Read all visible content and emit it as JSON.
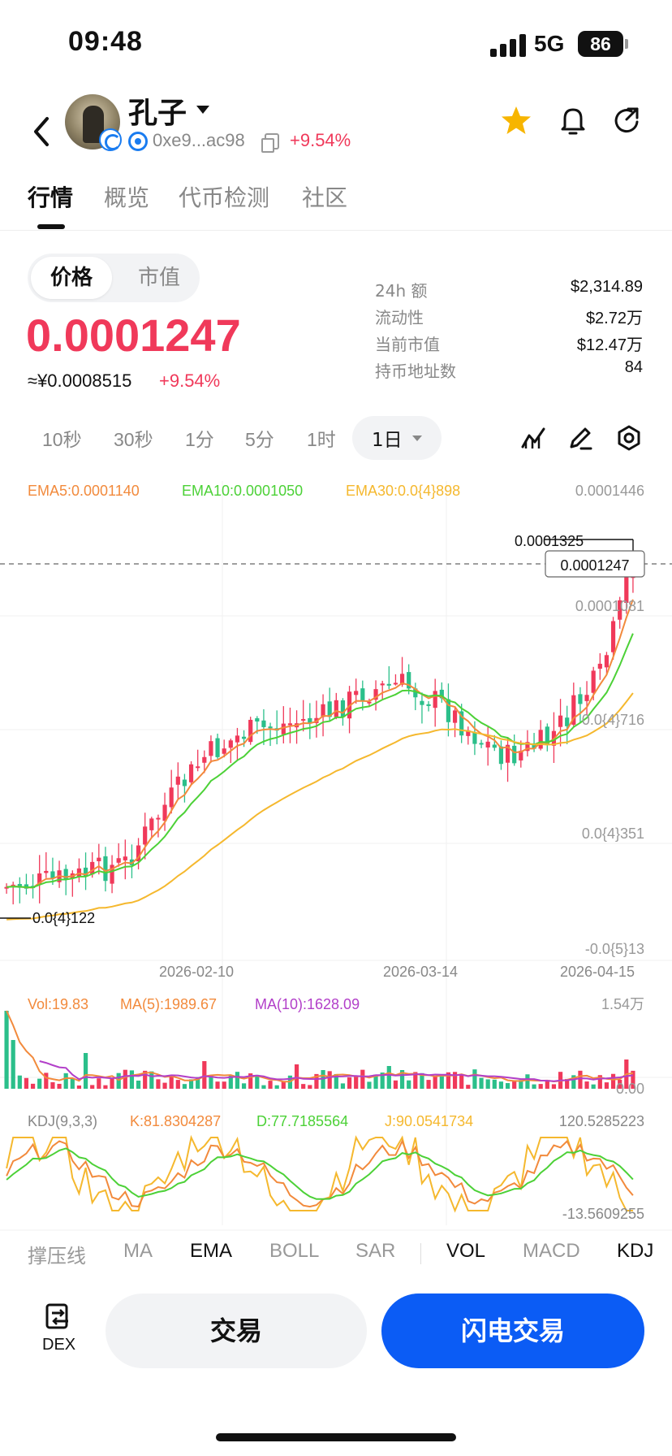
{
  "status": {
    "time": "09:48",
    "network": "5G",
    "battery": "86"
  },
  "header": {
    "token_name": "孔子",
    "address": "0xe9...ac98",
    "change": "+9.54%"
  },
  "tabs": [
    "行情",
    "概览",
    "代币检测",
    "社区"
  ],
  "price_panel": {
    "toggle": [
      "价格",
      "市值"
    ],
    "price": "0.0001247",
    "cny": "≈¥0.0008515",
    "cny_change": "+9.54%"
  },
  "stats": [
    {
      "label": "24h  额",
      "value": "$2,314.89"
    },
    {
      "label": "流动性",
      "value": "$2.72万"
    },
    {
      "label": "当前市值",
      "value": "$12.47万"
    },
    {
      "label": "持币地址数",
      "value": "84"
    }
  ],
  "timeframes": [
    "10秒",
    "30秒",
    "1分",
    "5分",
    "1时",
    "1日"
  ],
  "chart": {
    "ema_labels": {
      "ema5": "EMA5:0.0001140",
      "ema10": "EMA10:0.0001050",
      "ema30": "EMA30:0.0{4}898"
    },
    "y_ticks": [
      "0.0001446",
      "0.0001081",
      "0.0{4}716",
      "0.0{4}351",
      "-0.0{5}13"
    ],
    "high_label": "0.0001325",
    "current_price_tag": "0.0001247",
    "low_label": "0.0{4}122",
    "x_ticks": [
      "2026-02-10",
      "2026-03-14",
      "2026-04-15"
    ],
    "vol_labels": {
      "vol": "Vol:19.83",
      "ma5": "MA(5):1989.67",
      "ma10": "MA(10):1628.09"
    },
    "vol_max": "1.54万",
    "vol_zero": "0.00",
    "kdj_labels": {
      "name": "KDJ(9,3,3)",
      "k": "K:81.8304287",
      "d": "D:77.7185564",
      "j": "J:90.0541734"
    },
    "kdj_max": "120.5285223",
    "kdj_min": "-13.5609255",
    "colors": {
      "up": "#f0395a",
      "down": "#2bbf8a",
      "ema5": "#f28a3c",
      "ema10": "#4cd137",
      "ema30": "#f5b82e",
      "ma10": "#b23fc9"
    }
  },
  "indicators": [
    "撑压线",
    "MA",
    "EMA",
    "BOLL",
    "SAR",
    "VOL",
    "MACD",
    "KDJ"
  ],
  "bottom": {
    "dex": "DEX",
    "trade": "交易",
    "flash_trade": "闪电交易"
  }
}
